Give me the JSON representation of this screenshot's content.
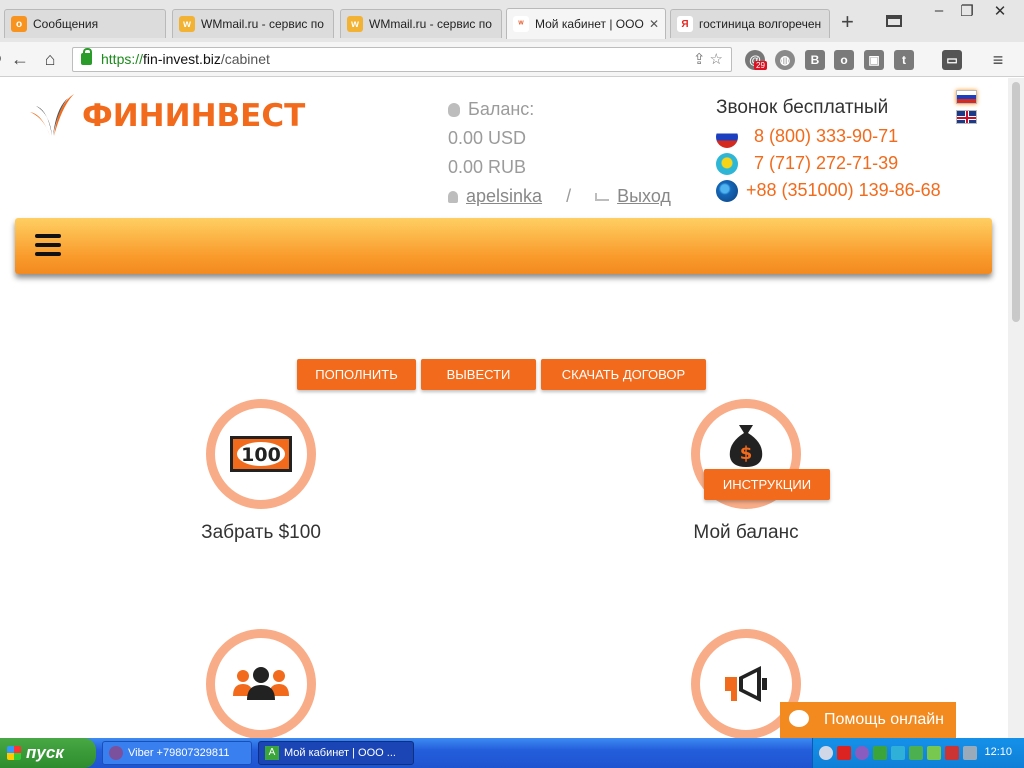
{
  "browser": {
    "tabs": [
      {
        "title": "Сообщения",
        "favicon": "odnoklassniki-icon",
        "color": "#f7931e",
        "active": false
      },
      {
        "title": "WMmail.ru - сервис по",
        "favicon": "wmmail-icon",
        "color": "#f2b233",
        "active": false
      },
      {
        "title": "WMmail.ru - сервис по",
        "favicon": "wmmail-icon",
        "color": "#f2b233",
        "active": false
      },
      {
        "title": "Мой кабинет | ООО",
        "favicon": "fininvest-icon",
        "color": "#e8592b",
        "active": true
      },
      {
        "title": "гостиница волгоречен",
        "favicon": "yandex-icon",
        "color": "#e52620",
        "active": false
      }
    ],
    "address": {
      "scheme": "https://",
      "host": "fin-invest.biz",
      "path": "/cabinet"
    },
    "extension_badge": "29"
  },
  "header": {
    "logo_text": "ФИНИНВЕСТ",
    "balance_label": "Баланс:",
    "balance_usd": "0.00 USD",
    "balance_rub": "0.00 RUB",
    "username": "apelsinka",
    "separator": "/",
    "logout": "Выход",
    "phones_header": "Звонок бесплатный",
    "phones": [
      {
        "country": "russia",
        "number": "8 (800) 333-90-71"
      },
      {
        "country": "kazakhstan",
        "number": "7 (717) 272-71-39"
      },
      {
        "country": "international",
        "number": "+88 (351000) 139-86-68"
      }
    ]
  },
  "actions": {
    "deposit": "ПОПОЛНИТЬ",
    "withdraw": "ВЫВЕСТИ",
    "download_contract": "СКАЧАТЬ ДОГОВОР",
    "instructions": "ИНСТРУКЦИИ"
  },
  "features": [
    {
      "label": "Забрать $100",
      "icon": "money-100-icon",
      "badge": "100"
    },
    {
      "label": "Мой баланс",
      "icon": "money-bag-icon"
    },
    {
      "label": "",
      "icon": "users-icon"
    },
    {
      "label": "",
      "icon": "megaphone-icon"
    }
  ],
  "help_chat": "Помощь онлайн",
  "taskbar": {
    "start": "пуск",
    "items": [
      {
        "title": "Viber +79807329811"
      },
      {
        "title": "Мой кабинет | ООО ..."
      }
    ],
    "clock": "12:10"
  },
  "colors": {
    "accent": "#f26a1b",
    "circle": "#f8ac87",
    "menubar": "#f99a2b"
  }
}
